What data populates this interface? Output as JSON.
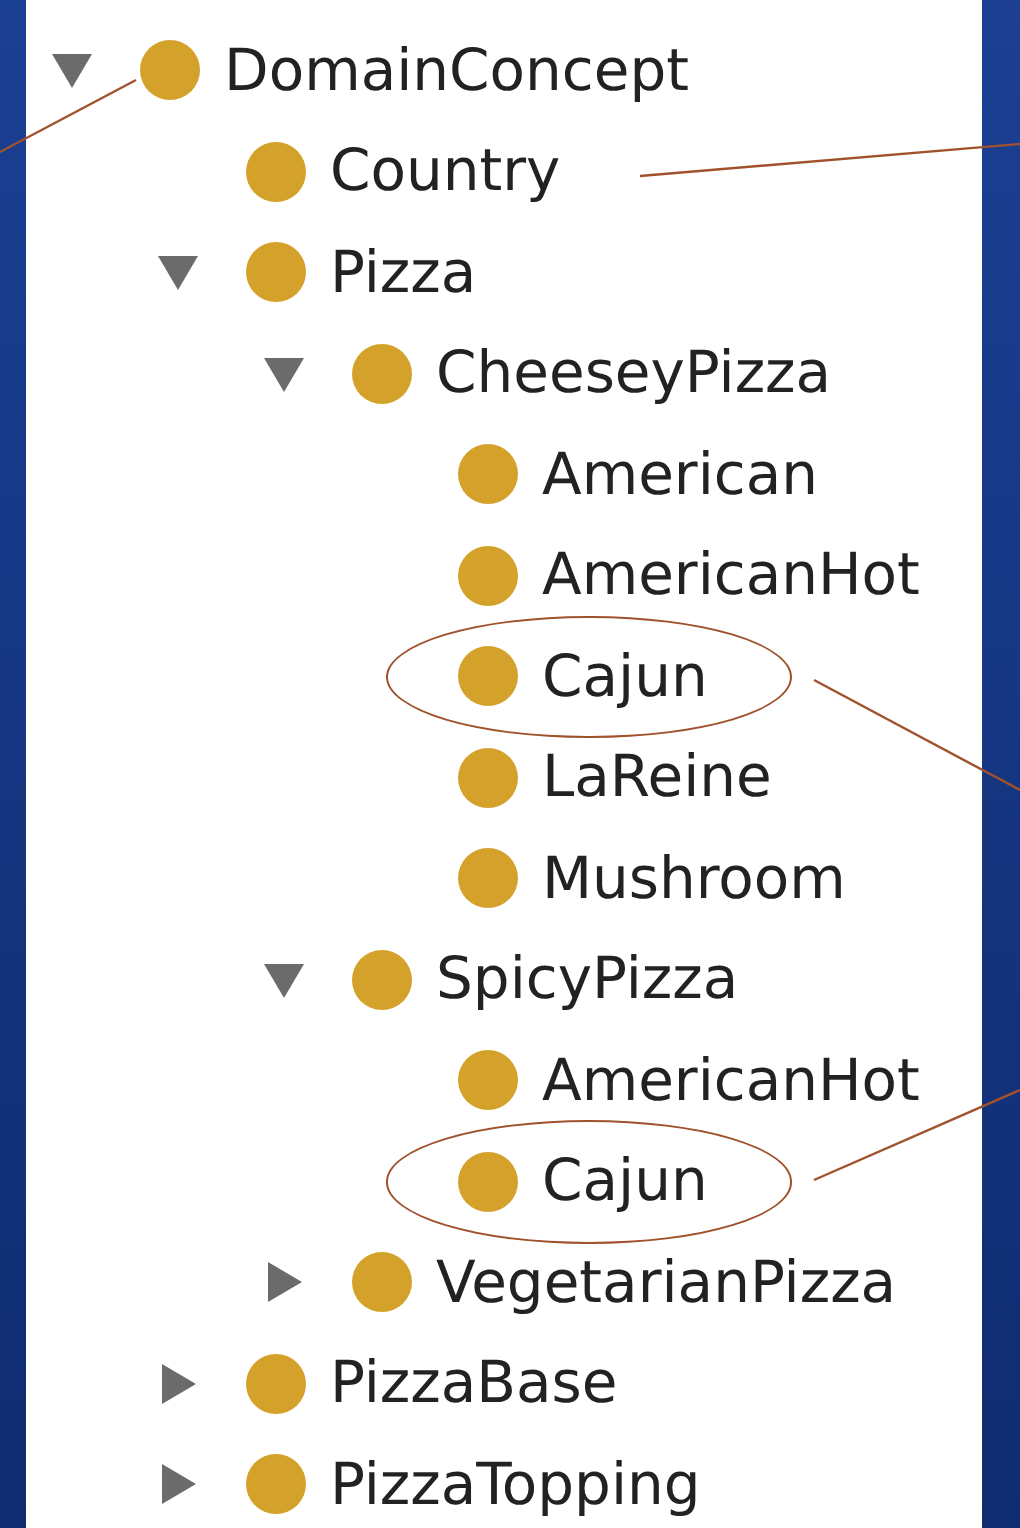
{
  "tree": [
    {
      "label": "DomainConcept",
      "expanded": true,
      "circled": false,
      "children": [
        {
          "label": "Country",
          "circled": false
        },
        {
          "label": "Pizza",
          "expanded": true,
          "circled": false,
          "children": [
            {
              "label": "CheeseyPizza",
              "expanded": true,
              "circled": false,
              "children": [
                {
                  "label": "American",
                  "circled": false
                },
                {
                  "label": "AmericanHot",
                  "circled": false
                },
                {
                  "label": "Cajun",
                  "circled": true
                },
                {
                  "label": "LaReine",
                  "circled": false
                },
                {
                  "label": "Mushroom",
                  "circled": false
                }
              ]
            },
            {
              "label": "SpicyPizza",
              "expanded": true,
              "circled": false,
              "children": [
                {
                  "label": "AmericanHot",
                  "circled": false
                },
                {
                  "label": "Cajun",
                  "circled": true
                }
              ]
            },
            {
              "label": "VegetarianPizza",
              "expanded": false,
              "circled": false
            }
          ]
        },
        {
          "label": "PizzaBase",
          "expanded": false,
          "circled": false
        },
        {
          "label": "PizzaTopping",
          "expanded": false,
          "circled": false
        }
      ]
    }
  ]
}
